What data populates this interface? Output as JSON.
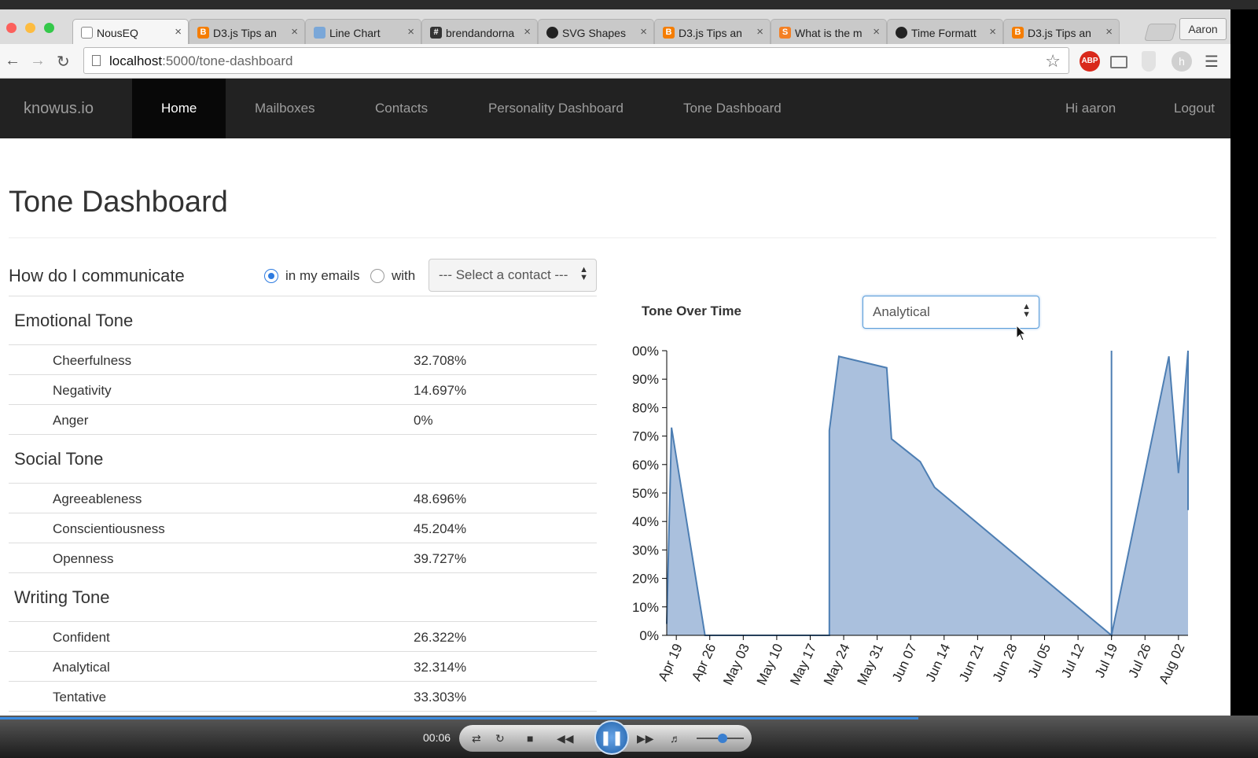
{
  "browser": {
    "tabs": [
      {
        "label": "NousEQ",
        "favicon": "page-icon",
        "active": true
      },
      {
        "label": "D3.js Tips an",
        "favicon": "blogger-icon"
      },
      {
        "label": "Line Chart",
        "favicon": "globe-icon"
      },
      {
        "label": "brendandorna",
        "favicon": "hash-icon"
      },
      {
        "label": "SVG Shapes",
        "favicon": "github-icon"
      },
      {
        "label": "D3.js Tips an",
        "favicon": "blogger-icon"
      },
      {
        "label": "What is the m",
        "favicon": "stackoverflow-icon"
      },
      {
        "label": "Time Formatt",
        "favicon": "github-icon"
      },
      {
        "label": "D3.js Tips an",
        "favicon": "blogger-icon"
      }
    ],
    "profile_name": "Aaron",
    "url_host": "localhost",
    "url_path": ":5000/tone-dashboard",
    "extension_label": "ABP"
  },
  "app": {
    "brand": "knowus.io",
    "nav": [
      "Home",
      "Mailboxes",
      "Contacts",
      "Personality Dashboard",
      "Tone Dashboard"
    ],
    "user_greeting": "Hi aaron",
    "logout": "Logout"
  },
  "page": {
    "title": "Tone Dashboard",
    "how_label": "How do I communicate",
    "radio_emails": "in my emails",
    "radio_with": "with",
    "contact_select": "--- Select a contact ---",
    "chart_label": "Tone Over Time",
    "tone_select": "Analytical"
  },
  "tone_sections": [
    {
      "title": "Emotional Tone",
      "rows": [
        {
          "name": "Cheerfulness",
          "value": "32.708%"
        },
        {
          "name": "Negativity",
          "value": "14.697%"
        },
        {
          "name": "Anger",
          "value": "0%"
        }
      ]
    },
    {
      "title": "Social Tone",
      "rows": [
        {
          "name": "Agreeableness",
          "value": "48.696%"
        },
        {
          "name": "Conscientiousness",
          "value": "45.204%"
        },
        {
          "name": "Openness",
          "value": "39.727%"
        }
      ]
    },
    {
      "title": "Writing Tone",
      "rows": [
        {
          "name": "Confident",
          "value": "26.322%"
        },
        {
          "name": "Analytical",
          "value": "32.314%"
        },
        {
          "name": "Tentative",
          "value": "33.303%"
        }
      ]
    }
  ],
  "chart_data": {
    "type": "area",
    "title": "",
    "series": [
      {
        "values": [
          {
            "date": "Apr 17",
            "y": 0.04
          },
          {
            "date": "Apr 18",
            "y": 0.73
          },
          {
            "date": "Apr 25",
            "y": 0.0
          },
          {
            "date": "May 21",
            "y": 0.0
          },
          {
            "date": "May 21",
            "y": 0.72
          },
          {
            "date": "May 23",
            "y": 0.98
          },
          {
            "date": "Jun 02",
            "y": 0.94
          },
          {
            "date": "Jun 03",
            "y": 0.69
          },
          {
            "date": "Jun 09",
            "y": 0.61
          },
          {
            "date": "Jun 12",
            "y": 0.52
          },
          {
            "date": "Jul 19",
            "y": 0.0
          },
          {
            "date": "Jul 19",
            "y": 1.0
          },
          {
            "date": "Jul 19",
            "y": 0.0
          },
          {
            "date": "Jul 31",
            "y": 0.98
          },
          {
            "date": "Aug 02",
            "y": 0.57
          },
          {
            "date": "Aug 04",
            "y": 1.0
          },
          {
            "date": "Aug 04",
            "y": 0.44
          }
        ]
      }
    ],
    "x_start": "Apr 17",
    "x_end": "Aug 04",
    "x_ticks": [
      "Apr 19",
      "Apr 26",
      "May 03",
      "May 10",
      "May 17",
      "May 24",
      "May 31",
      "Jun 07",
      "Jun 14",
      "Jun 21",
      "Jun 28",
      "Jul 05",
      "Jul 12",
      "Jul 19",
      "Jul 26",
      "Aug 02"
    ],
    "y_ticks": [
      "00%",
      "90%",
      "80%",
      "70%",
      "60%",
      "50%",
      "40%",
      "30%",
      "20%",
      "10%",
      "0%"
    ],
    "ylim": [
      0,
      1
    ],
    "fill_color": "#aac0dd",
    "line_color": "#4d7eb3",
    "grid": false
  },
  "player": {
    "timecode": "00:06",
    "progress": 0.73,
    "volume": 0.55
  }
}
